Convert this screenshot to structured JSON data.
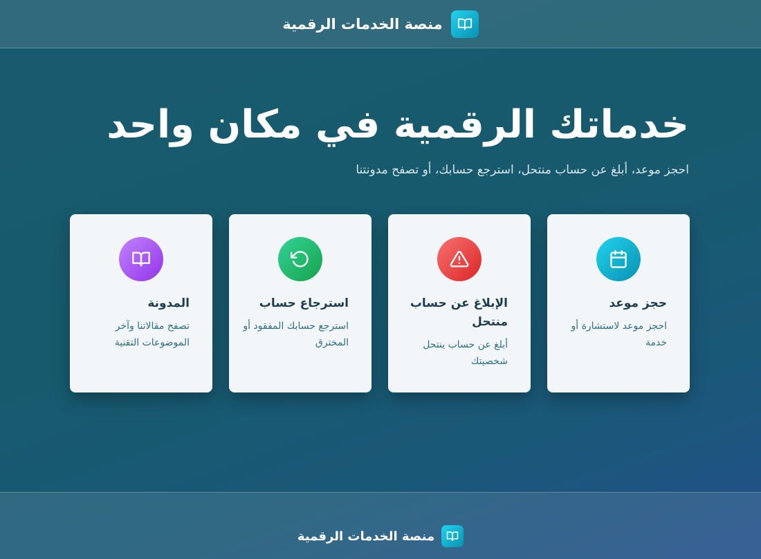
{
  "header": {
    "logo_icon": "book-open-icon",
    "title": "منصة الخدمات الرقمية"
  },
  "hero": {
    "title": "خدماتك الرقمية في مكان واحد",
    "subtitle": "احجز موعد، أبلغ عن حساب منتحل، استرجع حسابك، أو تصفح مدونتنا"
  },
  "services": [
    {
      "icon": "calendar-icon",
      "icon_color": "#06b6d4",
      "title": "حجز موعد",
      "description": "احجز موعد لاستشارة أو خدمة"
    },
    {
      "icon": "alert-triangle-icon",
      "icon_color": "#ef4444",
      "title": "الإبلاغ عن حساب منتحل",
      "description": "أبلغ عن حساب ينتحل شخصيتك"
    },
    {
      "icon": "rotate-ccw-icon",
      "icon_color": "#22c55e",
      "title": "استرجاع حساب",
      "description": "استرجع حسابك المفقود أو المخترق"
    },
    {
      "icon": "book-open-icon",
      "icon_color": "#a855f7",
      "title": "المدونة",
      "description": "تصفح مقالاتنا وآخر الموضوعات التقنية"
    }
  ],
  "footer": {
    "logo_icon": "book-open-icon",
    "title": "منصة الخدمات الرقمية"
  },
  "colors": {
    "background": "#175a6d",
    "accent": "#22d3ee",
    "card_background": "#f3f6f8",
    "card_title": "#1d3d4f",
    "card_text": "#2e6e86"
  }
}
